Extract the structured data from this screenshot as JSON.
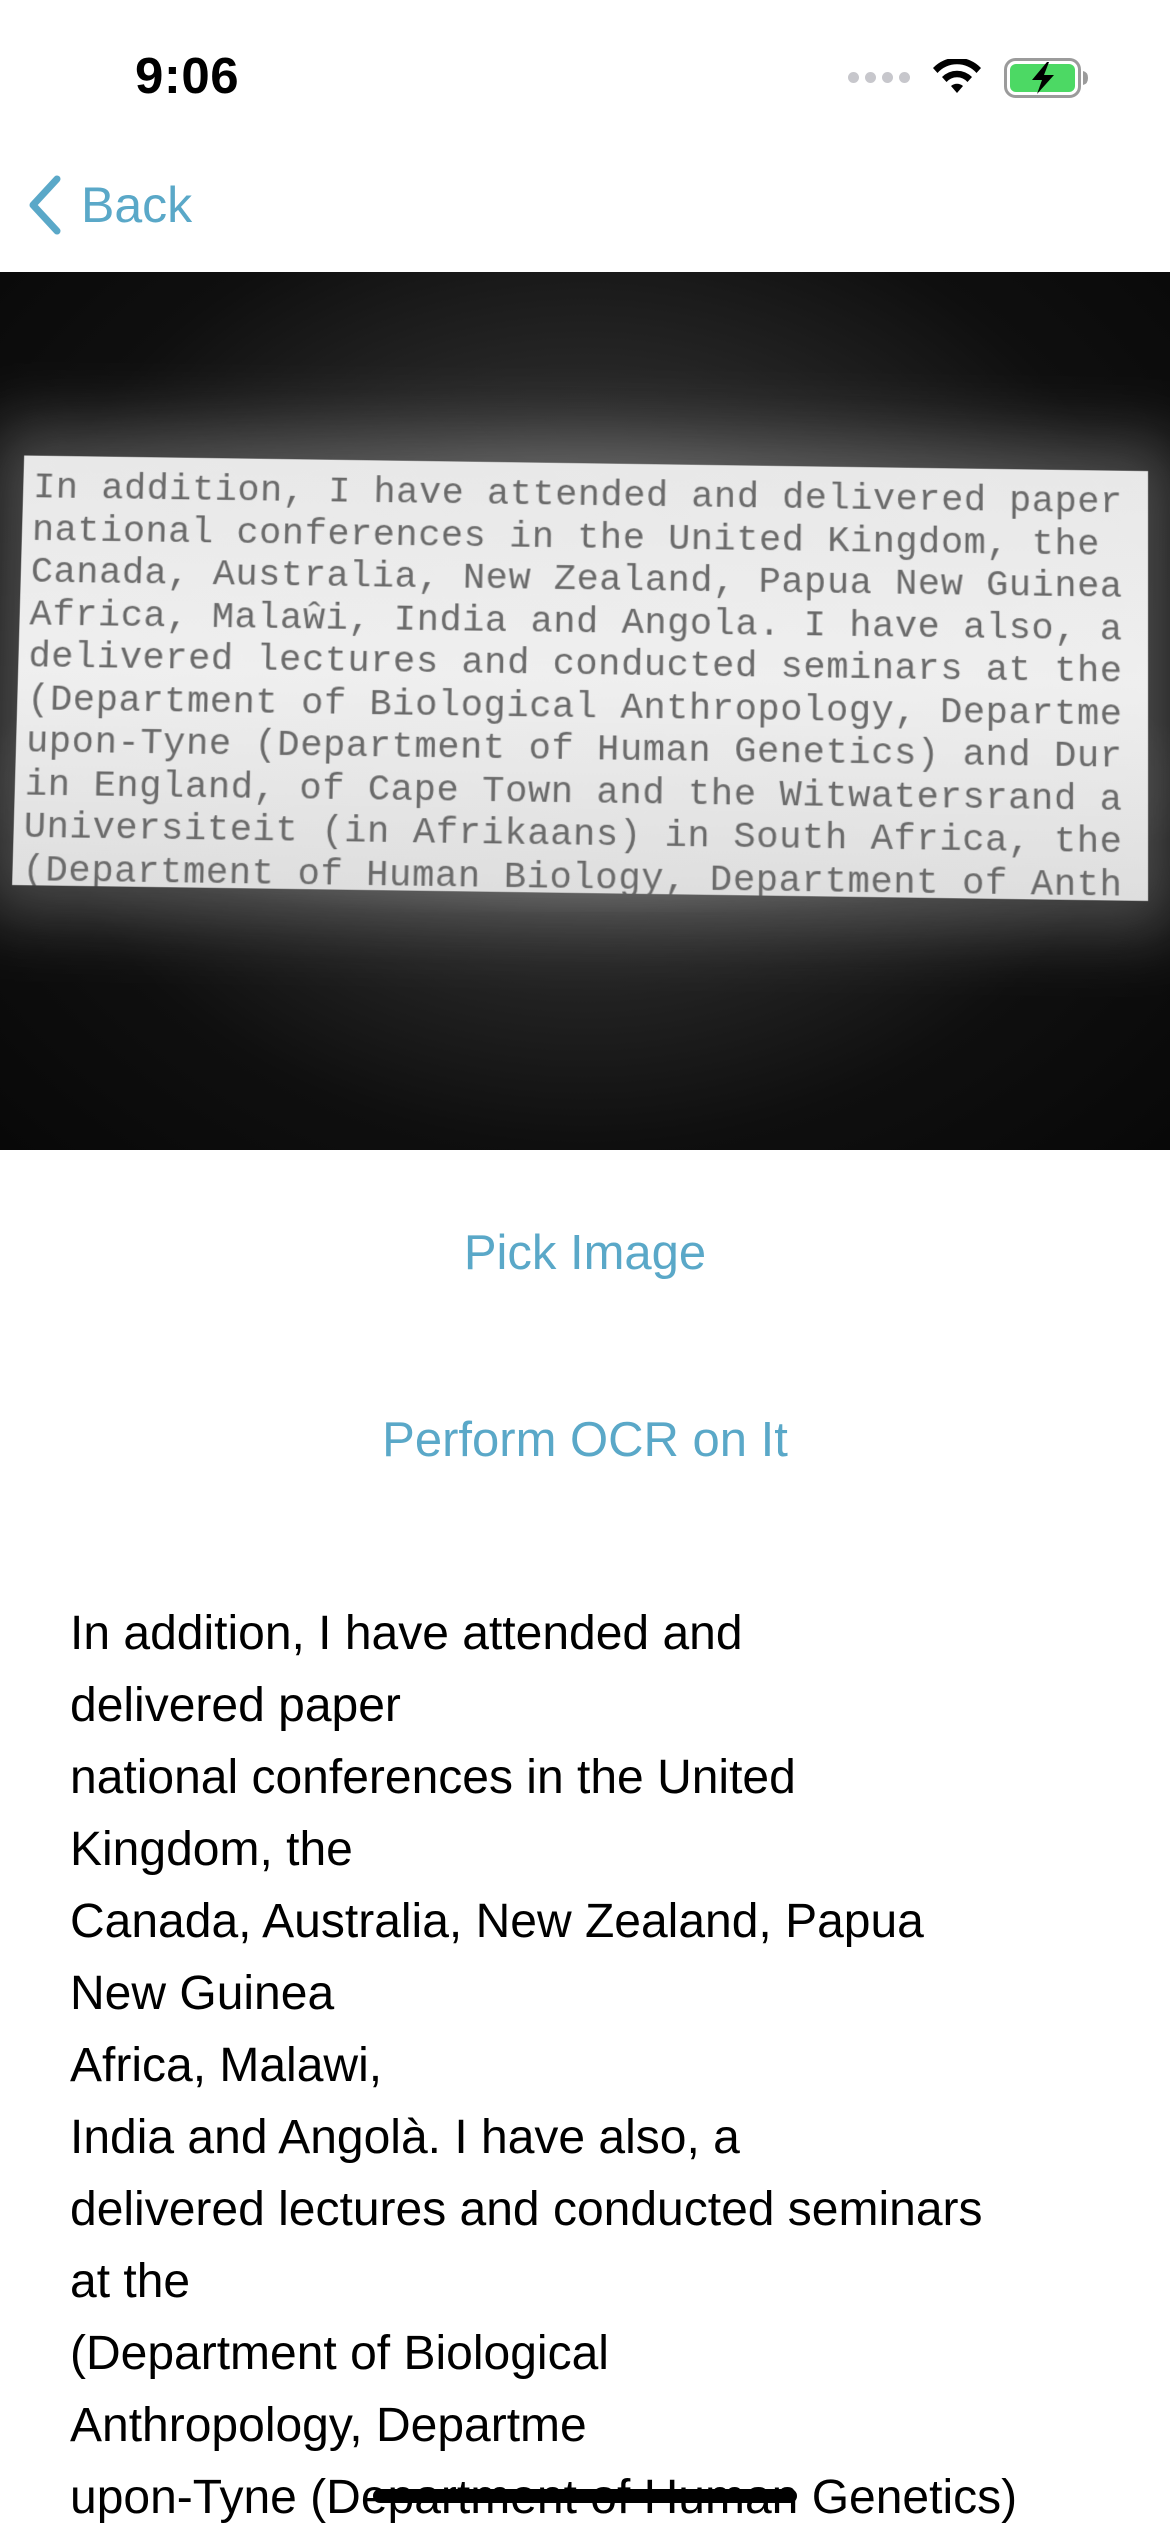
{
  "status_bar": {
    "time": "9:06",
    "icons": [
      "signal-dots-icon",
      "wifi-icon",
      "battery-charging-icon"
    ],
    "battery_color": "#4cd964"
  },
  "nav": {
    "back_label": "Back",
    "accent_color": "#5aa8c8"
  },
  "image_preview": {
    "lines": [
      "In addition, I have attended and delivered paper",
      "national conferences in the United Kingdom, the",
      "Canada, Australia, New Zealand, Papua New Guinea",
      "Africa, Malaŵi, India and Angola. I have also, a",
      "delivered lectures and conducted seminars at the",
      "(Department of Biological Anthropology, Departme",
      "upon-Tyne (Department of Human Genetics) and Dur",
      "in England, of Cape Town and the Witwatersrand a",
      "Universiteit (in Afrikaans) in South Africa, the",
      "(Department of Human Biology, Department of Anth"
    ]
  },
  "buttons": {
    "pick_image": "Pick Image",
    "perform_ocr": "Perform OCR on It"
  },
  "ocr_result": {
    "lines": [
      "In addition, I have attended and",
      "delivered paper",
      "national conferences in the United",
      "Kingdom, the",
      "Canada, Australia, New Zealand, Papua",
      "New Guinea",
      "Africa, Malawi,",
      "India and Angolà. I have also, a",
      "delivered lectures and conducted seminars",
      "at the",
      "(Department of Biological",
      "Anthropology, Departme",
      "upon-Tyne (Department of Human Genetics)"
    ]
  }
}
